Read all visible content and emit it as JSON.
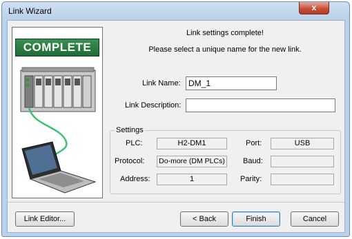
{
  "window": {
    "title": "Link Wizard",
    "close_glyph": "x"
  },
  "side_panel": {
    "banner": "COMPLETE"
  },
  "header": {
    "line1": "Link settings complete!",
    "line2": "Please select a unique name for the new link."
  },
  "form": {
    "link_name_label": "Link Name:",
    "link_name_value": "DM_1",
    "link_description_label": "Link Description:",
    "link_description_value": ""
  },
  "settings": {
    "group_label": "Settings",
    "plc_label": "PLC:",
    "plc_value": "H2-DM1",
    "protocol_label": "Protocol:",
    "protocol_value": "Do-more (DM PLCs)",
    "address_label": "Address:",
    "address_value": "1",
    "port_label": "Port:",
    "port_value": "USB",
    "baud_label": "Baud:",
    "baud_value": "",
    "parity_label": "Parity:",
    "parity_value": ""
  },
  "buttons": {
    "link_editor": "Link Editor...",
    "back": "< Back",
    "finish": "Finish",
    "cancel": "Cancel"
  },
  "colors": {
    "banner_green": "#2a7d44",
    "title_bar": "#b9d1ea",
    "close_red": "#c7503a"
  }
}
